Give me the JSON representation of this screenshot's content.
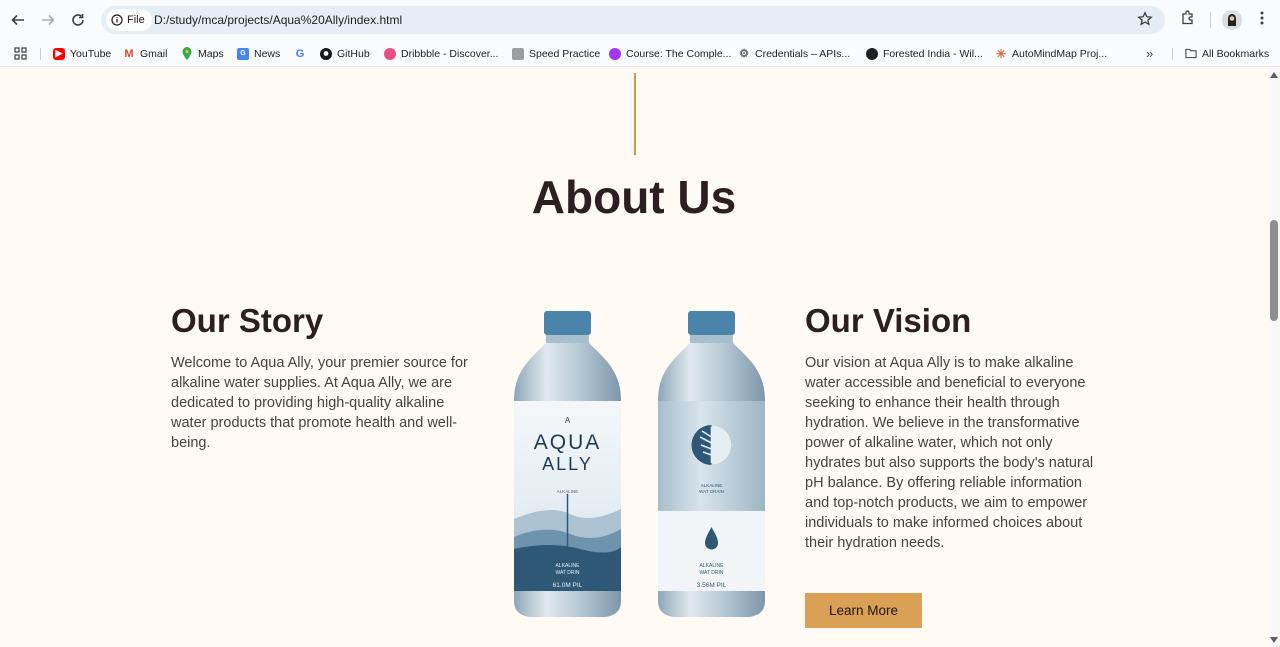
{
  "browser": {
    "file_chip": "File",
    "url": "D:/study/mca/projects/Aqua%20Ally/index.html"
  },
  "bookmarks": [
    {
      "label": "YouTube",
      "icon": "youtube-icon",
      "color": "#ff0000"
    },
    {
      "label": "Gmail",
      "icon": "gmail-icon",
      "color": "#ea4335"
    },
    {
      "label": "Maps",
      "icon": "maps-icon",
      "color": "#34a853"
    },
    {
      "label": "News",
      "icon": "news-icon",
      "color": "#4285f4"
    },
    {
      "label": "",
      "icon": "google-icon",
      "color": "#4285f4"
    },
    {
      "label": "GitHub",
      "icon": "github-icon",
      "color": "#181717"
    },
    {
      "label": "Dribbble - Discover...",
      "icon": "dribbble-icon",
      "color": "#ea4c89"
    },
    {
      "label": "Speed Practice",
      "icon": "speed-practice-icon",
      "color": "#9e9e9e"
    },
    {
      "label": "Course: The Comple...",
      "icon": "course-icon",
      "color": "#a435f0"
    },
    {
      "label": "Credentials – APIs...",
      "icon": "credentials-icon",
      "color": "#5f6368"
    },
    {
      "label": "Forested India - Wil...",
      "icon": "globe-icon",
      "color": "#202124"
    },
    {
      "label": "AutoMindMap Proj...",
      "icon": "automindmap-icon",
      "color": "#e8663d"
    }
  ],
  "all_bookmarks": "All Bookmarks",
  "about": {
    "title": "About Us"
  },
  "story": {
    "title": "Our Story",
    "text": "Welcome to Aqua Ally, your premier source for alkaline water supplies. At Aqua Ally, we are dedicated to providing high-quality alkaline water products that promote health and well-being."
  },
  "vision": {
    "title": "Our Vision",
    "text": "Our vision at Aqua Ally is to make alkaline water accessible and beneficial to everyone seeking to enhance their health through hydration. We believe in the transformative power of alkaline water, which not only hydrates but also supports the body's natural pH balance. By offering reliable information and top-notch products, we aim to empower individuals to make informed choices about their hydration needs.",
    "button": "Learn More"
  },
  "bottles": {
    "left_small": "A",
    "left_brand_1": "AQUA",
    "left_brand_2": "ALLY",
    "left_sub": "ALKALINE",
    "left_bottom_1": "ALKALINE",
    "left_bottom_2": "WAT DRIN",
    "left_volume": "61.0M PIL",
    "right_sub_1": "ALKALINE",
    "right_sub_2": "WAT DRAIN",
    "right_bottom_1": "ALKALINE",
    "right_bottom_2": "WAT DRIN",
    "right_volume": "3.56M PIL"
  },
  "colors": {
    "accent": "#d9a056",
    "heading": "#2d1f1f",
    "background": "#fffaf3",
    "divider": "#c59a50"
  }
}
